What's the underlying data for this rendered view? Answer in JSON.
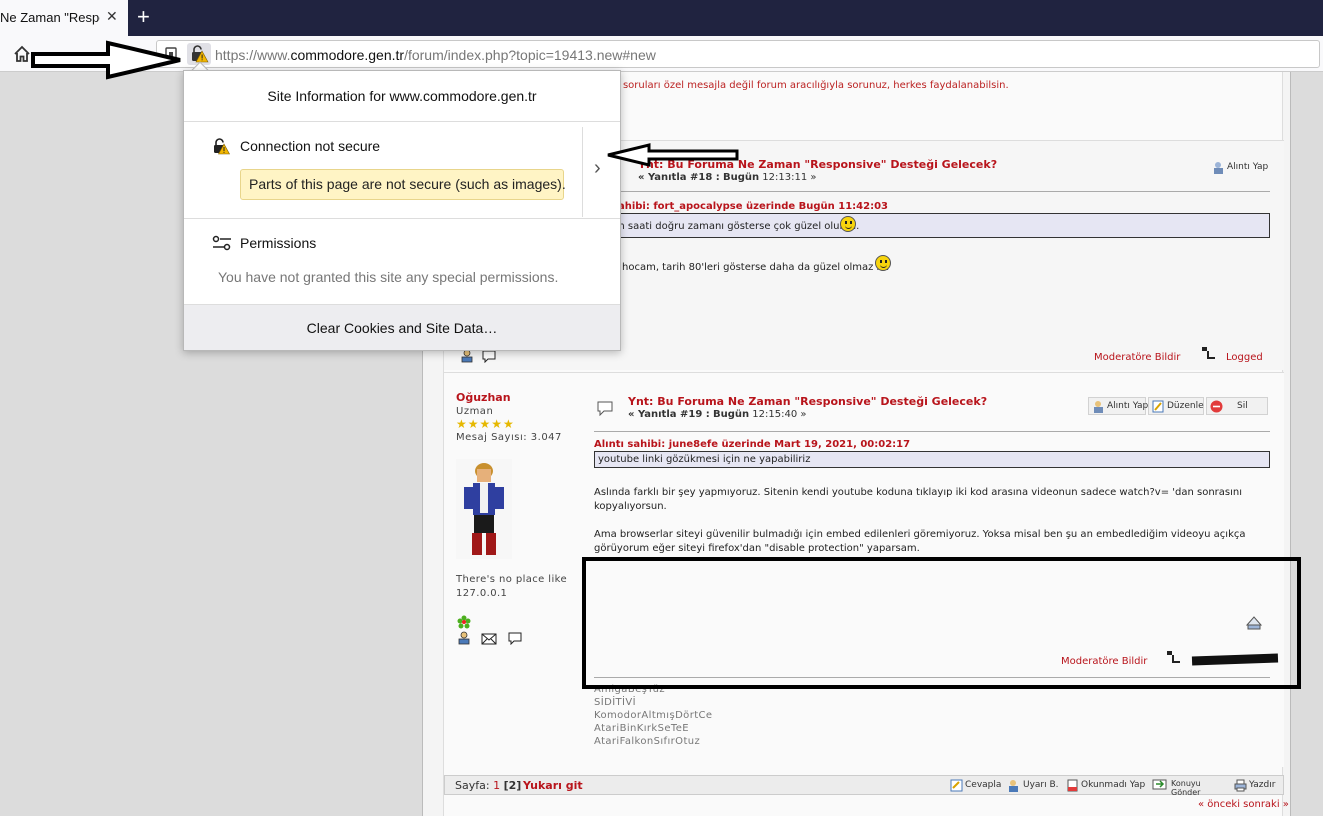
{
  "browser": {
    "tab_title": "Ne Zaman \"Responsive\" Desteği Gelecek?",
    "tab_title_visible": "Ne Zaman \"Respon",
    "url_prefix": "https://www.",
    "url_host": "commodore.gen.tr",
    "url_path": "/forum/index.php?topic=19413.new#new"
  },
  "popup": {
    "header": "Site Information for www.commodore.gen.tr",
    "connection_title": "Connection not secure",
    "connection_warning": "Parts of this page are not secure (such as images).",
    "permissions_title": "Permissions",
    "permissions_desc": "You have not granted this site any special permissions.",
    "clear_button": "Clear Cookies and Site Data…"
  },
  "forum": {
    "top_note": "k soruları özel mesajla değil forum aracılığıyla sorunuz, herkes faydalanabilsin.",
    "post18": {
      "title": "Ynt: Bu Foruma Ne Zaman \"Responsive\" Desteği Gelecek?",
      "reply_label": "« Yanıtla #18 :",
      "date": "Bugün",
      "time": "12:13:11 »",
      "quote_header": "sahibi: fort_apocalypse üzerinde Bugün  11:42:03",
      "quote_text": "m saati doğru zamanı gösterse çok güzel olurdu.",
      "body": "hocam, tarih 80'leri gösterse daha da güzel olmaz mı",
      "quote_btn": "Alıntı Yap",
      "report": "Moderatöre Bildir",
      "logged": "Logged"
    },
    "post19": {
      "author": "Oğuzhan",
      "rank": "Uzman",
      "stars": "★★★★★",
      "msg_count": "Mesaj Sayısı: 3.047",
      "signature_left": [
        "There's no place like",
        "127.0.0.1"
      ],
      "title": "Ynt: Bu Foruma Ne Zaman \"Responsive\" Desteği Gelecek?",
      "reply_label": "« Yanıtla #19 :",
      "date": "Bugün",
      "time": "12:15:40 »",
      "quote_btn": "Alıntı Yap",
      "edit_btn": "Düzenle",
      "delete_btn": "Sil",
      "quote_header": "Alıntı sahibi: june8efe üzerinde Mart 19, 2021, 00:02:17",
      "quote_text": "youtube linki gözükmesi için ne yapabiliriz",
      "body1": "Aslında farklı bir şey yapmıyoruz. Sitenin kendi youtube koduna tıklayıp iki kod arasına videonun sadece watch?v= 'dan sonrasını kopyalıyorsun.",
      "body2": "Ama browserlar siteyi güvenilir bulmadığı için embed edilenleri göremiyoruz. Yoksa misal ben şu an embedlediğim videoyu açıkça görüyorum eğer siteyi firefox'dan \"disable protection\" yaparsam.",
      "report": "Moderatöre Bildir",
      "signature_list": [
        "AmigaBeşYüz",
        "SİDİTİVİ",
        "KomodorAltmışDörtCe",
        "AtariBinKırkSeTeE",
        "AtariFalkonSıfırOtuz"
      ]
    },
    "pager": {
      "label": "Sayfa:",
      "page1": "1",
      "page2": "[2]",
      "top_link": "Yukarı git",
      "buttons": [
        "Cevapla",
        "Uyarı B.",
        "Okunmadı Yap",
        "Konuyu Gönder",
        "Yazdır"
      ]
    },
    "nav_bottom": "« önceki sonraki »"
  },
  "colors": {
    "tabstrip": "#202340",
    "forum_red": "#b8141b",
    "warning_bg": "#fff4c5"
  }
}
